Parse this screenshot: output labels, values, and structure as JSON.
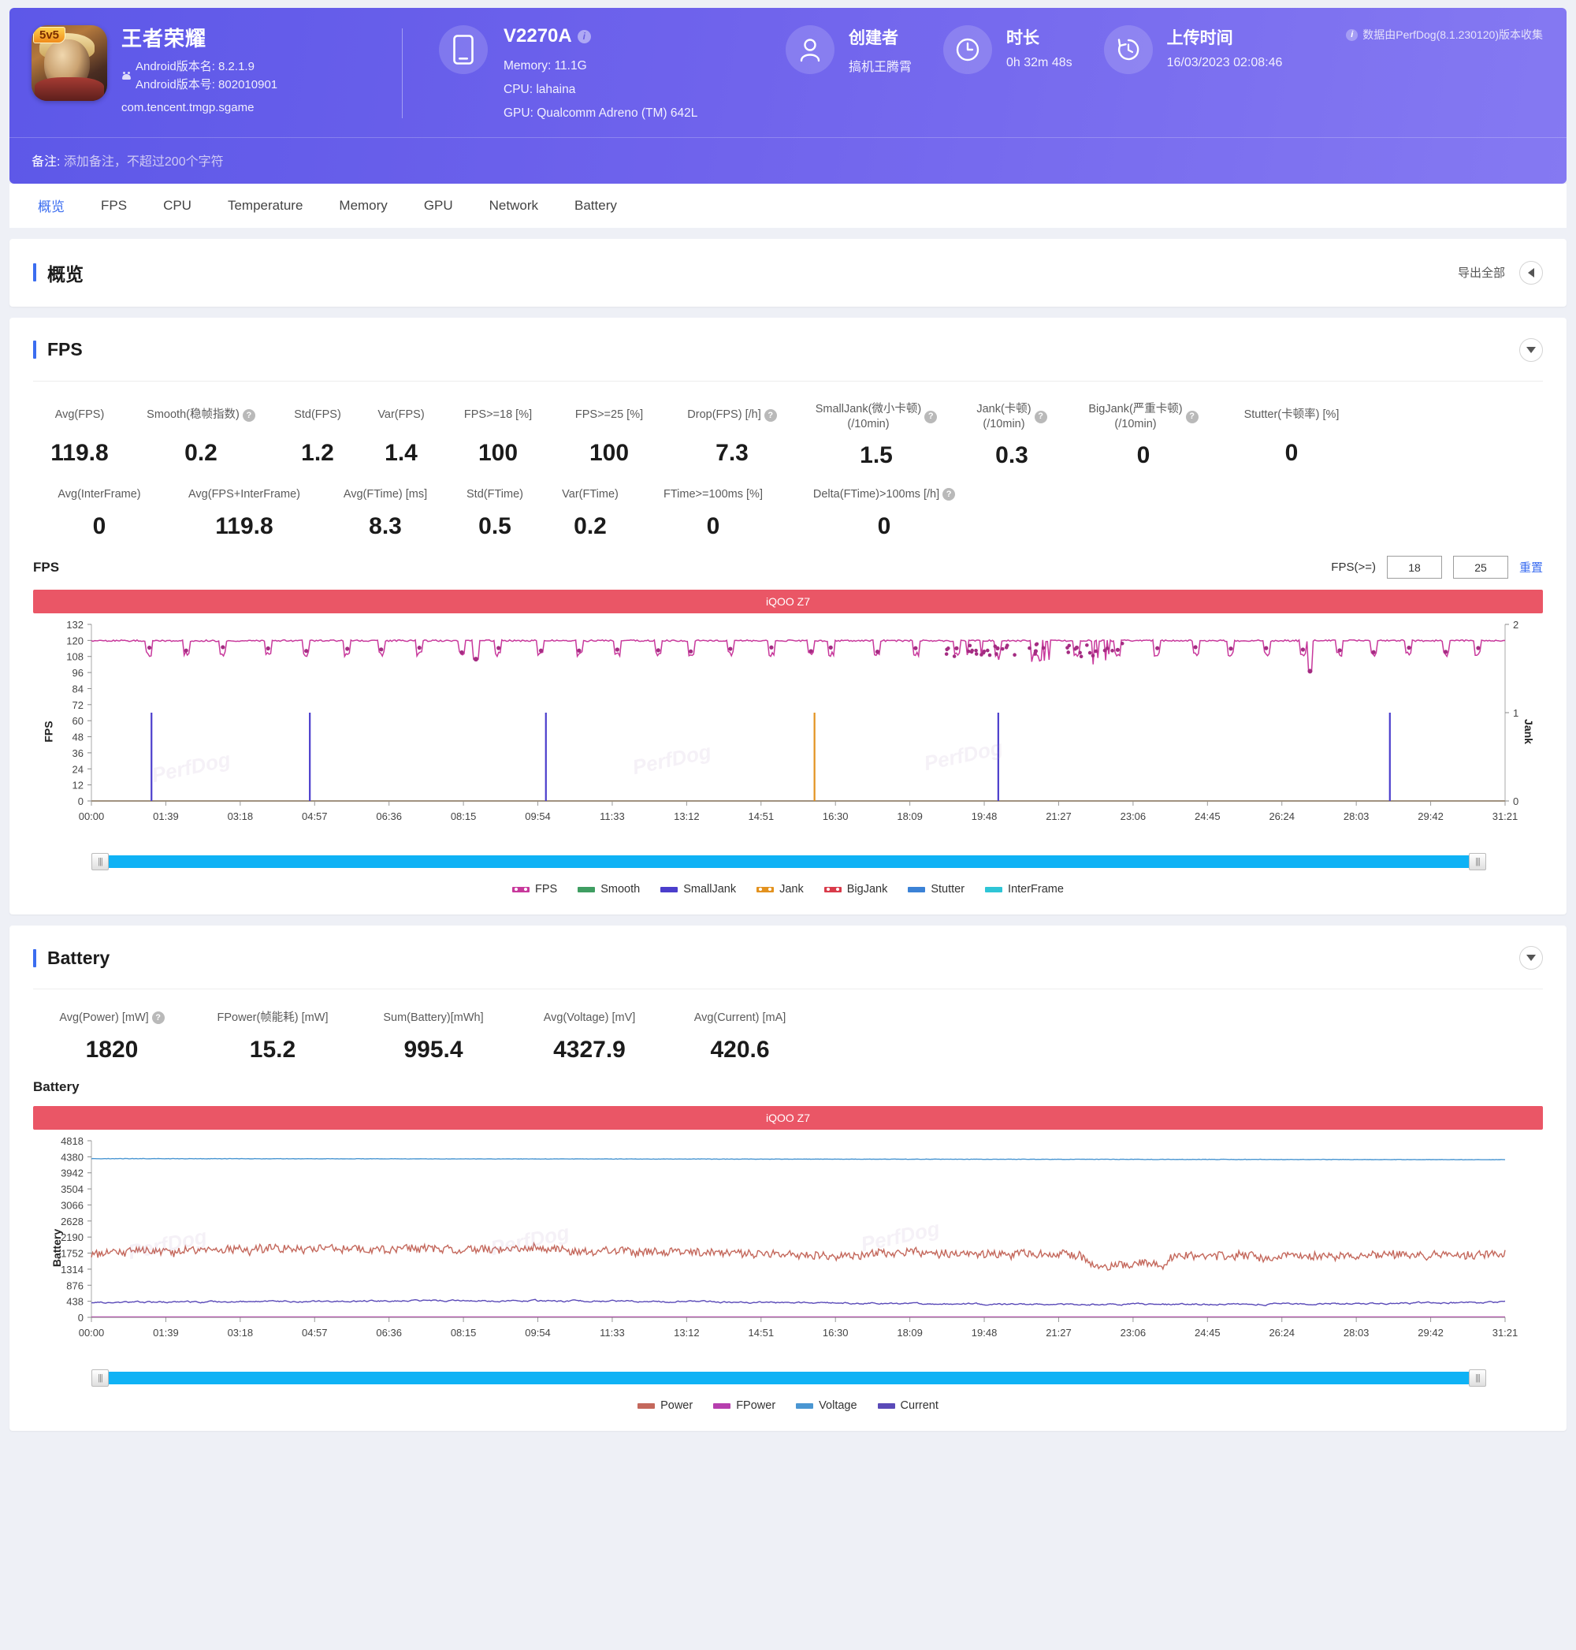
{
  "header": {
    "app": {
      "title": "王者荣耀",
      "badge": "5v5",
      "android_version_name_label": "Android版本名:",
      "android_version_name": "8.2.1.9",
      "android_version_code_label": "Android版本号:",
      "android_version_code": "802010901",
      "package": "com.tencent.tmgp.sgame"
    },
    "device": {
      "model": "V2270A",
      "memory": "Memory: 11.1G",
      "cpu": "CPU: lahaina",
      "gpu": "GPU: Qualcomm Adreno (TM) 642L"
    },
    "creator": {
      "label": "创建者",
      "value": "搞机王腾霄"
    },
    "duration": {
      "label": "时长",
      "value": "0h 32m 48s"
    },
    "upload": {
      "label": "上传时间",
      "value": "16/03/2023 02:08:46"
    },
    "collector": "数据由PerfDog(8.1.230120)版本收集",
    "note_label": "备注:",
    "note_placeholder": "添加备注，不超过200个字符"
  },
  "tabs": [
    {
      "label": "概览",
      "active": true
    },
    {
      "label": "FPS",
      "active": false
    },
    {
      "label": "CPU",
      "active": false
    },
    {
      "label": "Temperature",
      "active": false
    },
    {
      "label": "Memory",
      "active": false
    },
    {
      "label": "GPU",
      "active": false
    },
    {
      "label": "Network",
      "active": false
    },
    {
      "label": "Battery",
      "active": false
    }
  ],
  "overview": {
    "title": "概览",
    "export_label": "导出全部"
  },
  "fps_section": {
    "title": "FPS",
    "metrics_row1": [
      {
        "label": "Avg(FPS)",
        "value": "119.8",
        "help": false
      },
      {
        "label": "Smooth(稳帧指数)",
        "value": "0.2",
        "help": true
      },
      {
        "label": "Std(FPS)",
        "value": "1.2",
        "help": false
      },
      {
        "label": "Var(FPS)",
        "value": "1.4",
        "help": false
      },
      {
        "label": "FPS>=18 [%]",
        "value": "100",
        "help": false
      },
      {
        "label": "FPS>=25 [%]",
        "value": "100",
        "help": false
      },
      {
        "label": "Drop(FPS) [/h]",
        "value": "7.3",
        "help": true
      },
      {
        "label": "SmallJank(微小卡顿)\n(/10min)",
        "value": "1.5",
        "help": true
      },
      {
        "label": "Jank(卡顿)\n(/10min)",
        "value": "0.3",
        "help": true
      },
      {
        "label": "BigJank(严重卡顿)\n(/10min)",
        "value": "0",
        "help": true
      },
      {
        "label": "Stutter(卡顿率) [%]",
        "value": "0",
        "help": false
      }
    ],
    "metrics_row2": [
      {
        "label": "Avg(InterFrame)",
        "value": "0",
        "help": false
      },
      {
        "label": "Avg(FPS+InterFrame)",
        "value": "119.8",
        "help": false
      },
      {
        "label": "Avg(FTime) [ms]",
        "value": "8.3",
        "help": false
      },
      {
        "label": "Std(FTime)",
        "value": "0.5",
        "help": false
      },
      {
        "label": "Var(FTime)",
        "value": "0.2",
        "help": false
      },
      {
        "label": "FTime>=100ms [%]",
        "value": "0",
        "help": false
      },
      {
        "label": "Delta(FTime)>100ms [/h]",
        "value": "0",
        "help": true
      }
    ],
    "chart_label": "FPS",
    "controls": {
      "fps_ge_label": "FPS(>=)",
      "threshold1": "18",
      "threshold2": "25",
      "reset_label": "重置"
    },
    "device_bar": "iQOO Z7"
  },
  "battery_section": {
    "title": "Battery",
    "metrics": [
      {
        "label": "Avg(Power) [mW]",
        "value": "1820",
        "help": true
      },
      {
        "label": "FPower(帧能耗) [mW]",
        "value": "15.2",
        "help": false
      },
      {
        "label": "Sum(Battery)[mWh]",
        "value": "995.4",
        "help": false
      },
      {
        "label": "Avg(Voltage) [mV]",
        "value": "4327.9",
        "help": false
      },
      {
        "label": "Avg(Current) [mA]",
        "value": "420.6",
        "help": false
      }
    ],
    "chart_label": "Battery",
    "device_bar": "iQOO Z7"
  },
  "chart_data": [
    {
      "id": "fps-chart",
      "type": "line",
      "title": "iQOO Z7",
      "xlabel": "",
      "ylabel": "FPS",
      "y2label": "Jank",
      "ylim": [
        0,
        132
      ],
      "y2lim": [
        0,
        2
      ],
      "yticks": [
        0,
        12,
        24,
        36,
        48,
        60,
        72,
        84,
        96,
        108,
        120,
        132
      ],
      "y2ticks": [
        0,
        1,
        2
      ],
      "xticks": [
        "00:00",
        "01:39",
        "03:18",
        "04:57",
        "06:36",
        "08:15",
        "09:54",
        "11:33",
        "13:12",
        "14:51",
        "16:30",
        "18:09",
        "19:48",
        "21:27",
        "23:06",
        "24:45",
        "26:24",
        "28:03",
        "29:42",
        "31:21"
      ],
      "grid": false,
      "legend_position": "bottom",
      "series": [
        {
          "name": "FPS",
          "color": "#c8399c",
          "axis": "left",
          "avg": 119.8,
          "min": 96,
          "max": 121,
          "style": "line-dots"
        },
        {
          "name": "Smooth",
          "color": "#3f9e62",
          "axis": "left",
          "avg": 0.2,
          "style": "line"
        },
        {
          "name": "SmallJank",
          "color": "#4b3ecc",
          "axis": "right",
          "spikes": [
            [
              1.4,
              1
            ],
            [
              5.0,
              1
            ],
            [
              10.5,
              1
            ],
            [
              21.0,
              1
            ],
            [
              29.8,
              1
            ]
          ],
          "style": "impulse"
        },
        {
          "name": "Jank",
          "color": "#e3921f",
          "axis": "right",
          "spikes": [
            [
              16.8,
              1
            ]
          ],
          "style": "impulse"
        },
        {
          "name": "BigJank",
          "color": "#d93b4a",
          "axis": "right",
          "spikes": [],
          "style": "impulse"
        },
        {
          "name": "Stutter",
          "color": "#3b82d6",
          "axis": "right",
          "values_flat": 0,
          "style": "line"
        },
        {
          "name": "InterFrame",
          "color": "#2ec5d6",
          "axis": "left",
          "values_flat": 0,
          "style": "line"
        }
      ]
    },
    {
      "id": "battery-chart",
      "type": "line",
      "title": "iQOO Z7",
      "xlabel": "",
      "ylabel": "Battery",
      "ylim": [
        0,
        4818
      ],
      "yticks": [
        0,
        438,
        876,
        1314,
        1752,
        2190,
        2628,
        3066,
        3504,
        3942,
        4380,
        4818
      ],
      "xticks": [
        "00:00",
        "01:39",
        "03:18",
        "04:57",
        "06:36",
        "08:15",
        "09:54",
        "11:33",
        "13:12",
        "14:51",
        "16:30",
        "18:09",
        "19:48",
        "21:27",
        "23:06",
        "24:45",
        "26:24",
        "28:03",
        "29:42",
        "31:21"
      ],
      "grid": false,
      "legend_position": "bottom",
      "series": [
        {
          "name": "Power",
          "color": "#c4685c",
          "avg": 1820,
          "min": 1350,
          "max": 2150,
          "style": "line"
        },
        {
          "name": "FPower",
          "color": "#b63fae",
          "avg": 15.2,
          "style": "line"
        },
        {
          "name": "Voltage",
          "color": "#4a96d2",
          "avg": 4327.9,
          "style": "line"
        },
        {
          "name": "Current",
          "color": "#5a4ab8",
          "avg": 420.6,
          "min": 330,
          "max": 470,
          "style": "line"
        }
      ]
    }
  ],
  "fps_legend": [
    {
      "label": "FPS",
      "color": "#c8399c",
      "dotted": true
    },
    {
      "label": "Smooth",
      "color": "#3f9e62",
      "dotted": false
    },
    {
      "label": "SmallJank",
      "color": "#4b3ecc",
      "dotted": false
    },
    {
      "label": "Jank",
      "color": "#e3921f",
      "dotted": true
    },
    {
      "label": "BigJank",
      "color": "#d93b4a",
      "dotted": true
    },
    {
      "label": "Stutter",
      "color": "#3b82d6",
      "dotted": false
    },
    {
      "label": "InterFrame",
      "color": "#2ec5d6",
      "dotted": false
    }
  ],
  "battery_legend": [
    {
      "label": "Power",
      "color": "#c4685c"
    },
    {
      "label": "FPower",
      "color": "#b63fae"
    },
    {
      "label": "Voltage",
      "color": "#4a96d2"
    },
    {
      "label": "Current",
      "color": "#5a4ab8"
    }
  ],
  "watermark_text": "PerfDog"
}
